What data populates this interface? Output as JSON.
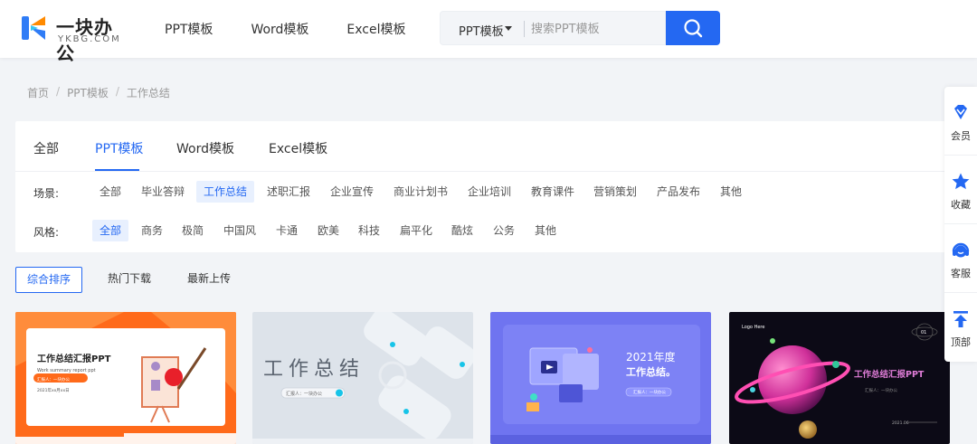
{
  "header": {
    "logo": {
      "title": "一块办公",
      "subtitle": "YKBG.COM"
    },
    "nav": [
      "PPT模板",
      "Word模板",
      "Excel模板"
    ],
    "search": {
      "type": "PPT模板",
      "placeholder": "搜索PPT模板"
    }
  },
  "breadcrumb": [
    "首页",
    "PPT模板",
    "工作总结"
  ],
  "filter": {
    "tabs": [
      "全部",
      "PPT模板",
      "Word模板",
      "Excel模板"
    ],
    "active_tab": "PPT模板",
    "scene": {
      "label": "场景:",
      "options": [
        "全部",
        "毕业答辩",
        "工作总结",
        "述职汇报",
        "企业宣传",
        "商业计划书",
        "企业培训",
        "教育课件",
        "营销策划",
        "产品发布",
        "其他"
      ],
      "selected": "工作总结"
    },
    "style": {
      "label": "风格:",
      "options": [
        "全部",
        "商务",
        "极简",
        "中国风",
        "卡通",
        "欧美",
        "科技",
        "扁平化",
        "酷炫",
        "公务",
        "其他"
      ],
      "selected": "全部"
    }
  },
  "sort": {
    "options": [
      "综合排序",
      "热门下载",
      "最新上传"
    ],
    "selected": "综合排序"
  },
  "cards": [
    {
      "title": "工作总结汇报PPT",
      "subtitle": "Work summary report ppt",
      "reporter": "汇报人：一块办公",
      "date": "2021年xx月xx日"
    },
    {
      "title": "工作总结",
      "reporter": "汇报人：一块办公"
    },
    {
      "title_line1": "2021年度",
      "title_line2": "工作总结。",
      "reporter": "汇报人：一块办公"
    },
    {
      "title": "工作总结汇报PPT",
      "logo": "Logo Here",
      "reporter": "汇报人：一块办公",
      "date": "2021.06",
      "badge": "01"
    }
  ],
  "sidebar": [
    {
      "label": "会员",
      "icon": "diamond-icon"
    },
    {
      "label": "收藏",
      "icon": "star-icon"
    },
    {
      "label": "客服",
      "icon": "headset-icon"
    },
    {
      "label": "顶部",
      "icon": "arrow-up-icon"
    }
  ],
  "colors": {
    "primary": "#2468f2",
    "background": "#f2f4f7"
  }
}
